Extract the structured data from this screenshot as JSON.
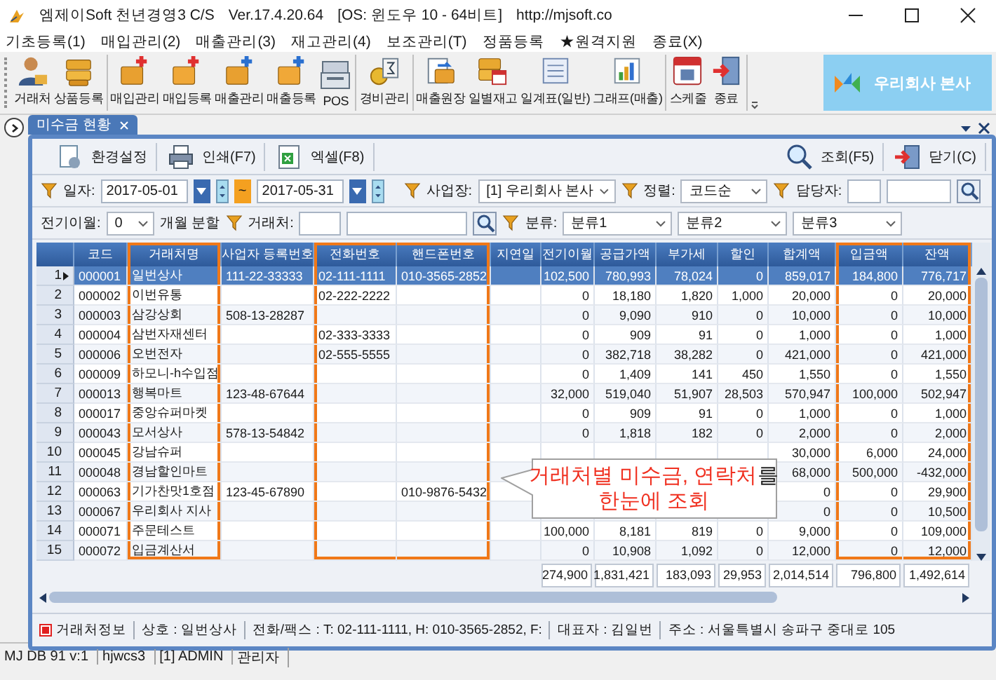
{
  "window": {
    "title": "엠제이Soft 천년경영3 C/S",
    "version": "Ver.17.4.20.64",
    "os": "[OS: 윈도우 10 - 64비트]",
    "url": "http://mjsoft.co"
  },
  "menu": [
    "기초등록(1)",
    "매입관리(2)",
    "매출관리(3)",
    "재고관리(4)",
    "보조관리(T)",
    "정품등록",
    "★원격지원",
    "종료(X)"
  ],
  "toolbar": {
    "groups": [
      [
        "거래처",
        "상품등록"
      ],
      [
        "매입관리",
        "매입등록",
        "매출관리",
        "매출등록",
        "POS"
      ],
      [
        "경비관리"
      ],
      [
        "매출원장",
        "일별재고",
        "일계표(일반)",
        "그래프(매출)"
      ],
      [
        "스케줄",
        "종료"
      ]
    ],
    "company": "우리회사 본사"
  },
  "tabs": [
    {
      "label": "미수금 현황",
      "selected": true
    }
  ],
  "actions": {
    "left": [
      "환경설정",
      "인쇄(F7)",
      "엑셀(F8)"
    ],
    "right": [
      "조회(F5)",
      "닫기(C)"
    ]
  },
  "filters": {
    "date_label": "일자:",
    "date_from": "2017-05-01",
    "date_sep": "~",
    "date_to": "2017-05-31",
    "site_label": "사업장:",
    "site": "[1] 우리회사 본사",
    "sort_label": "정렬:",
    "sort": "코드순",
    "manager_label": "담당자:",
    "carry_label": "전기이월:",
    "carry": "0",
    "split_label": "개월 분할",
    "customer_label": "거래처:",
    "category_label": "분류:",
    "categories": [
      "분류1",
      "분류2",
      "분류3"
    ]
  },
  "table": {
    "columns": [
      {
        "label": "코드",
        "highlighted": false
      },
      {
        "label": "거래처명",
        "highlighted": true
      },
      {
        "label": "사업자 등록번호",
        "highlighted": false
      },
      {
        "label": "전화번호",
        "highlighted": true
      },
      {
        "label": "핸드폰번호",
        "highlighted": true
      },
      {
        "label": "지연일",
        "highlighted": false
      },
      {
        "label": "전기이월",
        "highlighted": false
      },
      {
        "label": "공급가액",
        "highlighted": false
      },
      {
        "label": "부가세",
        "highlighted": false
      },
      {
        "label": "할인",
        "highlighted": false
      },
      {
        "label": "합계액",
        "highlighted": false
      },
      {
        "label": "입금액",
        "highlighted": true
      },
      {
        "label": "잔액",
        "highlighted": true
      }
    ],
    "rows": [
      {
        "no": "1",
        "selected": true,
        "cells": [
          "000001",
          "일번상사",
          "111-22-33333",
          "02-111-1111",
          "010-3565-2852",
          null,
          "102,500",
          "780,993",
          "78,024",
          "0",
          "859,017",
          "184,800",
          "776,717"
        ]
      },
      {
        "no": "2",
        "selected": false,
        "cells": [
          "000002",
          "이번유통",
          null,
          "02-222-2222",
          null,
          null,
          "0",
          "18,180",
          "1,820",
          "1,000",
          "20,000",
          "0",
          "20,000"
        ]
      },
      {
        "no": "3",
        "selected": false,
        "cells": [
          "000003",
          "삼강상회",
          "508-13-28287",
          null,
          null,
          null,
          "0",
          "9,090",
          "910",
          "0",
          "10,000",
          "0",
          "10,000"
        ]
      },
      {
        "no": "4",
        "selected": false,
        "cells": [
          "000004",
          "삼번자재센터",
          null,
          "02-333-3333",
          null,
          null,
          "0",
          "909",
          "91",
          "0",
          "1,000",
          "0",
          "1,000"
        ]
      },
      {
        "no": "5",
        "selected": false,
        "cells": [
          "000006",
          "오번전자",
          null,
          "02-555-5555",
          null,
          null,
          "0",
          "382,718",
          "38,282",
          "0",
          "421,000",
          "0",
          "421,000"
        ]
      },
      {
        "no": "6",
        "selected": false,
        "cells": [
          "000009",
          "하모니-h수입점",
          null,
          null,
          null,
          null,
          "0",
          "1,409",
          "141",
          "450",
          "1,550",
          "0",
          "1,550"
        ]
      },
      {
        "no": "7",
        "selected": false,
        "cells": [
          "000013",
          "행복마트",
          "123-48-67644",
          null,
          null,
          null,
          "32,000",
          "519,040",
          "51,907",
          "28,503",
          "570,947",
          "100,000",
          "502,947"
        ]
      },
      {
        "no": "8",
        "selected": false,
        "cells": [
          "000017",
          "중앙슈퍼마켓",
          null,
          null,
          null,
          null,
          "0",
          "909",
          "91",
          "0",
          "1,000",
          "0",
          "1,000"
        ]
      },
      {
        "no": "9",
        "selected": false,
        "cells": [
          "000043",
          "모서상사",
          "578-13-54842",
          null,
          null,
          null,
          "0",
          "1,818",
          "182",
          "0",
          "2,000",
          "0",
          "2,000"
        ]
      },
      {
        "no": "10",
        "selected": false,
        "cells": [
          "000045",
          "강남슈퍼",
          null,
          null,
          null,
          null,
          null,
          null,
          null,
          null,
          "30,000",
          "6,000",
          "24,000"
        ]
      },
      {
        "no": "11",
        "selected": false,
        "cells": [
          "000048",
          "경남할인마트",
          null,
          null,
          null,
          null,
          null,
          null,
          null,
          null,
          "68,000",
          "500,000",
          "-432,000"
        ]
      },
      {
        "no": "12",
        "selected": false,
        "cells": [
          "000063",
          "기가찬맛1호점",
          "123-45-67890",
          null,
          "010-9876-5432",
          null,
          null,
          null,
          null,
          null,
          "0",
          "0",
          "29,900"
        ]
      },
      {
        "no": "13",
        "selected": false,
        "cells": [
          "000067",
          "우리회사 지사",
          null,
          null,
          null,
          null,
          null,
          null,
          null,
          null,
          "0",
          "0",
          "10,500"
        ]
      },
      {
        "no": "14",
        "selected": false,
        "cells": [
          "000071",
          "주문테스트",
          null,
          null,
          null,
          null,
          "100,000",
          "8,181",
          "819",
          "0",
          "9,000",
          "0",
          "109,000"
        ]
      },
      {
        "no": "15",
        "selected": false,
        "cells": [
          "000072",
          "입금계산서",
          null,
          null,
          null,
          null,
          "0",
          "10,908",
          "1,092",
          "0",
          "12,000",
          "0",
          "12,000"
        ]
      }
    ],
    "totals": [
      "274,900",
      "1,831,421",
      "183,093",
      "29,953",
      "2,014,514",
      "796,800",
      "1,492,614"
    ]
  },
  "callout": [
    [
      {
        "text": "거래처별 미수금, 연락처",
        "emphasis": true
      },
      {
        "text": "를",
        "emphasis": false
      }
    ],
    [
      {
        "text": "한눈에 조회",
        "emphasis": true
      }
    ]
  ],
  "info_bar": {
    "title": "거래처정보",
    "fields": [
      "상호 : 일번상사",
      "전화/팩스 : T: 02-111-1111, H: 010-3565-2852, F:",
      "대표자 : 김일번",
      "주소 : 서울특별시 송파구 중대로 105"
    ]
  },
  "status_bar": [
    "MJ DB 91 v:1",
    "hjwcs3",
    "[1] ADMIN",
    "관리자"
  ]
}
